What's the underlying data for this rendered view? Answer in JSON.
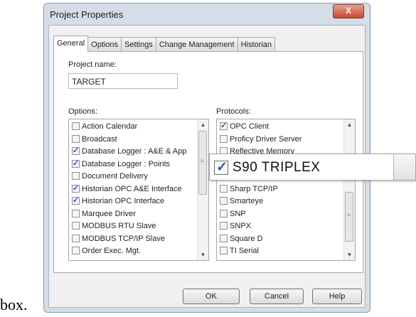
{
  "dialog": {
    "title": "Project Properties",
    "close_label": "X"
  },
  "tabs": [
    {
      "label": "General"
    },
    {
      "label": "Options"
    },
    {
      "label": "Settings"
    },
    {
      "label": "Change Management"
    },
    {
      "label": "Historian"
    }
  ],
  "project_name": {
    "label": "Project name:",
    "value": "TARGET"
  },
  "options": {
    "label": "Options:",
    "items": [
      {
        "label": "Action Calendar",
        "checked": false
      },
      {
        "label": "Broadcast",
        "checked": false
      },
      {
        "label": "Database Logger : A&E & App",
        "checked": true
      },
      {
        "label": "Database Logger : Points",
        "checked": true
      },
      {
        "label": "Document Delivery",
        "checked": false
      },
      {
        "label": "Historian OPC A&E Interface",
        "checked": true
      },
      {
        "label": "Historian OPC Interface",
        "checked": true
      },
      {
        "label": "Marquee Driver",
        "checked": false
      },
      {
        "label": "MODBUS RTU Slave",
        "checked": false
      },
      {
        "label": "MODBUS TCP/IP Slave",
        "checked": false
      },
      {
        "label": "Order Exec. Mgt.",
        "checked": false
      }
    ]
  },
  "protocols": {
    "label": "Protocols:",
    "items": [
      {
        "label": "OPC Client",
        "checked": true
      },
      {
        "label": "Proficy Driver Server",
        "checked": false
      },
      {
        "label": "Reflective Memory",
        "checked": false
      },
      {
        "label": "",
        "checked": false
      },
      {
        "label": "",
        "checked": false
      },
      {
        "label": "Sharp TCP/IP",
        "checked": false
      },
      {
        "label": "Smarteye",
        "checked": false
      },
      {
        "label": "SNP",
        "checked": false
      },
      {
        "label": "SNPX",
        "checked": false
      },
      {
        "label": "Square D",
        "checked": false
      },
      {
        "label": "TI Serial",
        "checked": false
      }
    ]
  },
  "zoom_callout": {
    "label": "S90 TRIPLEX",
    "checked": true
  },
  "buttons": {
    "ok": "OK",
    "cancel": "Cancel",
    "help": "Help"
  },
  "caption": "box."
}
